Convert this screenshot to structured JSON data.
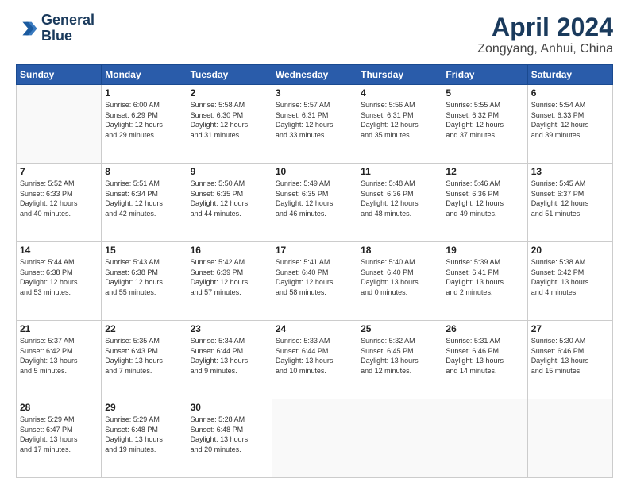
{
  "header": {
    "logo_line1": "General",
    "logo_line2": "Blue",
    "title": "April 2024",
    "subtitle": "Zongyang, Anhui, China"
  },
  "weekdays": [
    "Sunday",
    "Monday",
    "Tuesday",
    "Wednesday",
    "Thursday",
    "Friday",
    "Saturday"
  ],
  "weeks": [
    [
      {
        "day": "",
        "info": ""
      },
      {
        "day": "1",
        "info": "Sunrise: 6:00 AM\nSunset: 6:29 PM\nDaylight: 12 hours\nand 29 minutes."
      },
      {
        "day": "2",
        "info": "Sunrise: 5:58 AM\nSunset: 6:30 PM\nDaylight: 12 hours\nand 31 minutes."
      },
      {
        "day": "3",
        "info": "Sunrise: 5:57 AM\nSunset: 6:31 PM\nDaylight: 12 hours\nand 33 minutes."
      },
      {
        "day": "4",
        "info": "Sunrise: 5:56 AM\nSunset: 6:31 PM\nDaylight: 12 hours\nand 35 minutes."
      },
      {
        "day": "5",
        "info": "Sunrise: 5:55 AM\nSunset: 6:32 PM\nDaylight: 12 hours\nand 37 minutes."
      },
      {
        "day": "6",
        "info": "Sunrise: 5:54 AM\nSunset: 6:33 PM\nDaylight: 12 hours\nand 39 minutes."
      }
    ],
    [
      {
        "day": "7",
        "info": "Sunrise: 5:52 AM\nSunset: 6:33 PM\nDaylight: 12 hours\nand 40 minutes."
      },
      {
        "day": "8",
        "info": "Sunrise: 5:51 AM\nSunset: 6:34 PM\nDaylight: 12 hours\nand 42 minutes."
      },
      {
        "day": "9",
        "info": "Sunrise: 5:50 AM\nSunset: 6:35 PM\nDaylight: 12 hours\nand 44 minutes."
      },
      {
        "day": "10",
        "info": "Sunrise: 5:49 AM\nSunset: 6:35 PM\nDaylight: 12 hours\nand 46 minutes."
      },
      {
        "day": "11",
        "info": "Sunrise: 5:48 AM\nSunset: 6:36 PM\nDaylight: 12 hours\nand 48 minutes."
      },
      {
        "day": "12",
        "info": "Sunrise: 5:46 AM\nSunset: 6:36 PM\nDaylight: 12 hours\nand 49 minutes."
      },
      {
        "day": "13",
        "info": "Sunrise: 5:45 AM\nSunset: 6:37 PM\nDaylight: 12 hours\nand 51 minutes."
      }
    ],
    [
      {
        "day": "14",
        "info": "Sunrise: 5:44 AM\nSunset: 6:38 PM\nDaylight: 12 hours\nand 53 minutes."
      },
      {
        "day": "15",
        "info": "Sunrise: 5:43 AM\nSunset: 6:38 PM\nDaylight: 12 hours\nand 55 minutes."
      },
      {
        "day": "16",
        "info": "Sunrise: 5:42 AM\nSunset: 6:39 PM\nDaylight: 12 hours\nand 57 minutes."
      },
      {
        "day": "17",
        "info": "Sunrise: 5:41 AM\nSunset: 6:40 PM\nDaylight: 12 hours\nand 58 minutes."
      },
      {
        "day": "18",
        "info": "Sunrise: 5:40 AM\nSunset: 6:40 PM\nDaylight: 13 hours\nand 0 minutes."
      },
      {
        "day": "19",
        "info": "Sunrise: 5:39 AM\nSunset: 6:41 PM\nDaylight: 13 hours\nand 2 minutes."
      },
      {
        "day": "20",
        "info": "Sunrise: 5:38 AM\nSunset: 6:42 PM\nDaylight: 13 hours\nand 4 minutes."
      }
    ],
    [
      {
        "day": "21",
        "info": "Sunrise: 5:37 AM\nSunset: 6:42 PM\nDaylight: 13 hours\nand 5 minutes."
      },
      {
        "day": "22",
        "info": "Sunrise: 5:35 AM\nSunset: 6:43 PM\nDaylight: 13 hours\nand 7 minutes."
      },
      {
        "day": "23",
        "info": "Sunrise: 5:34 AM\nSunset: 6:44 PM\nDaylight: 13 hours\nand 9 minutes."
      },
      {
        "day": "24",
        "info": "Sunrise: 5:33 AM\nSunset: 6:44 PM\nDaylight: 13 hours\nand 10 minutes."
      },
      {
        "day": "25",
        "info": "Sunrise: 5:32 AM\nSunset: 6:45 PM\nDaylight: 13 hours\nand 12 minutes."
      },
      {
        "day": "26",
        "info": "Sunrise: 5:31 AM\nSunset: 6:46 PM\nDaylight: 13 hours\nand 14 minutes."
      },
      {
        "day": "27",
        "info": "Sunrise: 5:30 AM\nSunset: 6:46 PM\nDaylight: 13 hours\nand 15 minutes."
      }
    ],
    [
      {
        "day": "28",
        "info": "Sunrise: 5:29 AM\nSunset: 6:47 PM\nDaylight: 13 hours\nand 17 minutes."
      },
      {
        "day": "29",
        "info": "Sunrise: 5:29 AM\nSunset: 6:48 PM\nDaylight: 13 hours\nand 19 minutes."
      },
      {
        "day": "30",
        "info": "Sunrise: 5:28 AM\nSunset: 6:48 PM\nDaylight: 13 hours\nand 20 minutes."
      },
      {
        "day": "",
        "info": ""
      },
      {
        "day": "",
        "info": ""
      },
      {
        "day": "",
        "info": ""
      },
      {
        "day": "",
        "info": ""
      }
    ]
  ]
}
